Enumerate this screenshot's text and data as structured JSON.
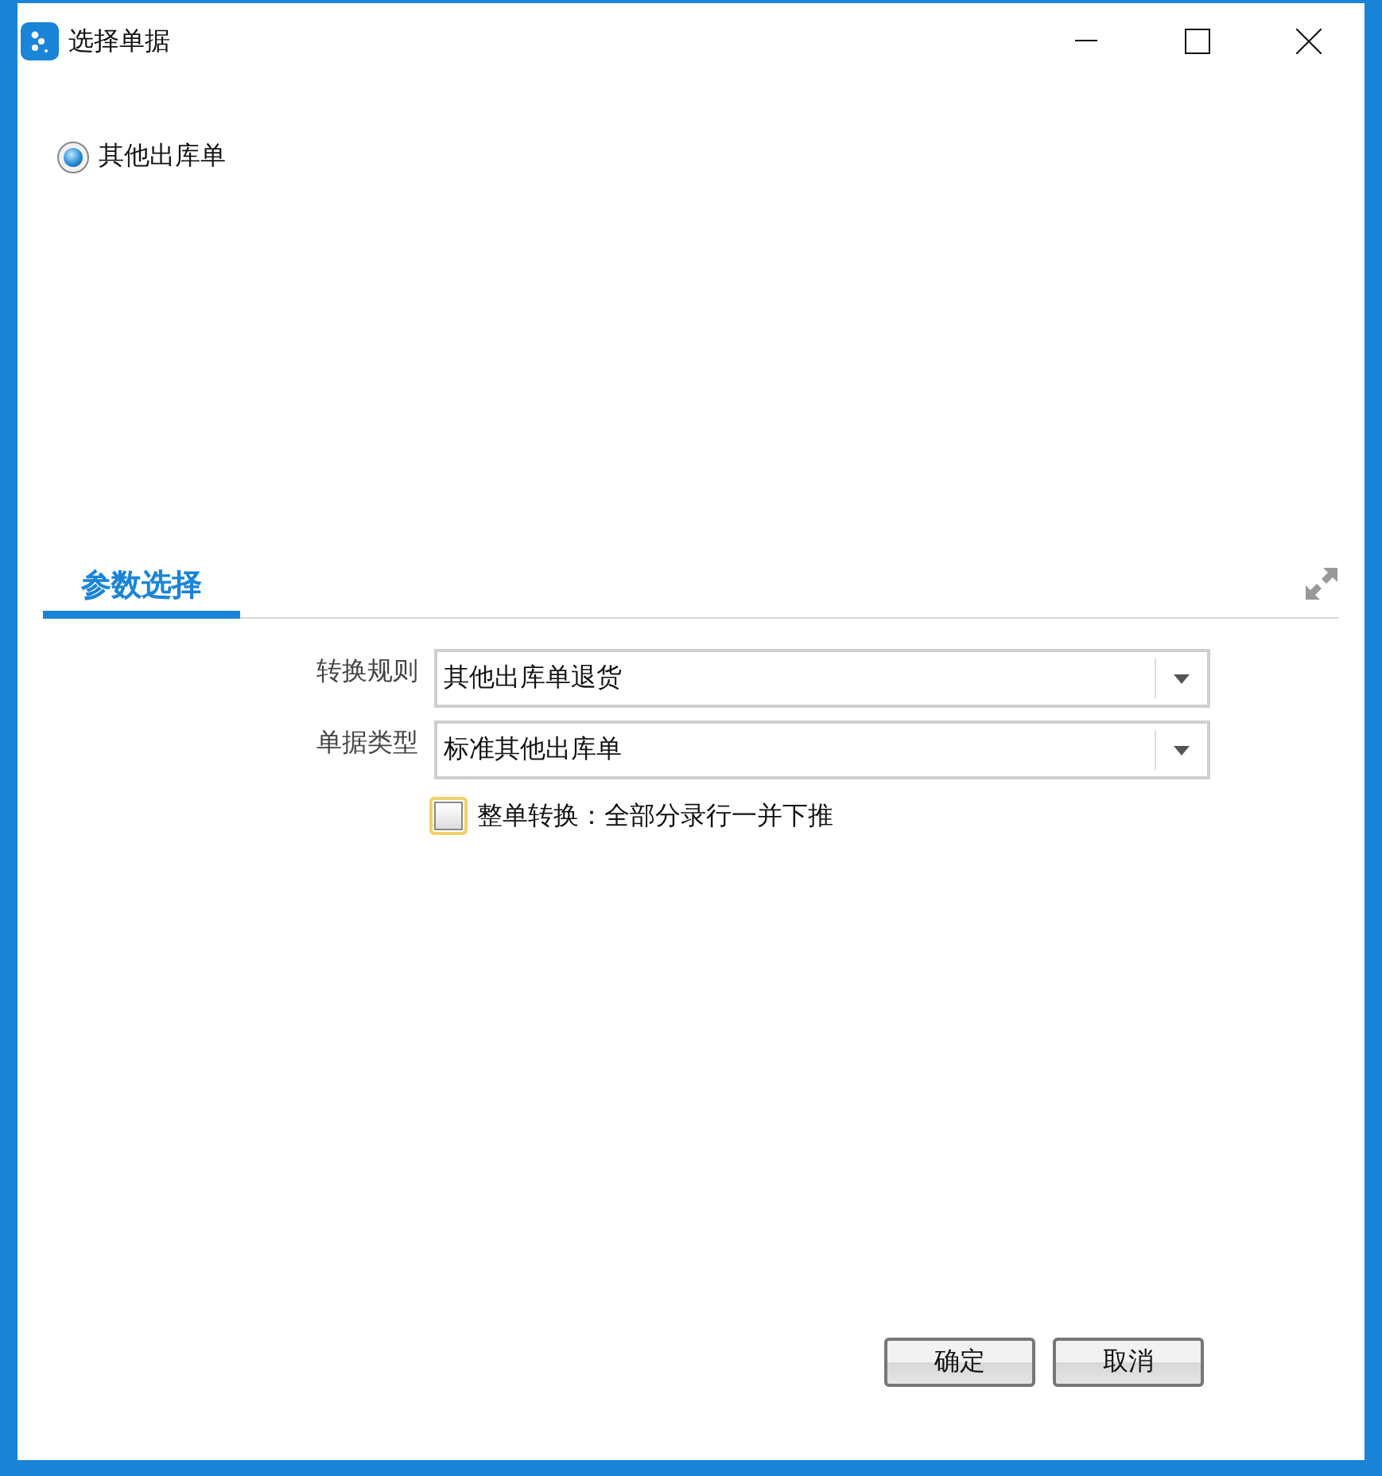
{
  "window": {
    "title": "选择单据"
  },
  "document_types": [
    {
      "label": "其他出库单",
      "selected": true
    }
  ],
  "tabs": [
    {
      "label": "参数选择",
      "selected": true
    }
  ],
  "fields": [
    {
      "label": "转换规则",
      "value": "其他出库单退货"
    },
    {
      "label": "单据类型",
      "value": "标准其他出库单"
    }
  ],
  "whole_conversion": {
    "label": "整单转换：全部分录行一并下推",
    "checked": false
  },
  "buttons": [
    "确定",
    "取消"
  ]
}
